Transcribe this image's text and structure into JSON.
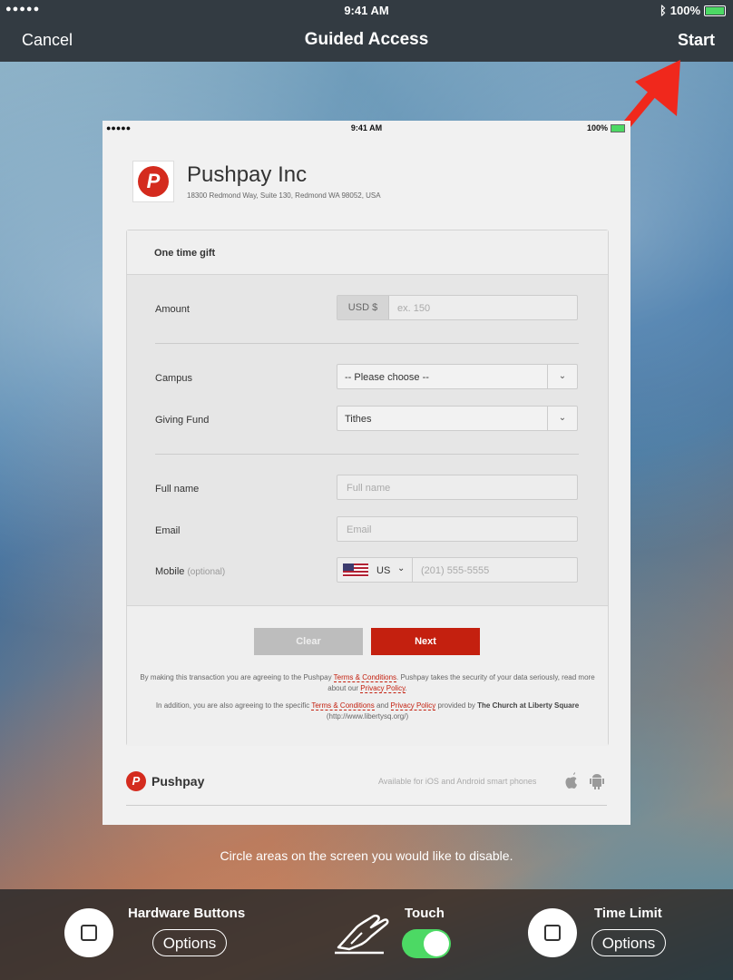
{
  "status_bar": {
    "signal": "●●●●● ",
    "time": "9:41 AM",
    "battery": "100%"
  },
  "nav": {
    "cancel": "Cancel",
    "title": "Guided Access",
    "start": "Start"
  },
  "inner_status": {
    "signal": "●●●●● ",
    "time": "9:41 AM",
    "battery": "100%"
  },
  "merchant": {
    "name": "Pushpay Inc",
    "address": "18300 Redmond Way, Suite 130, Redmond WA 98052, USA"
  },
  "form": {
    "header": "One time gift",
    "amount": {
      "label": "Amount",
      "currency": "USD $",
      "placeholder": "ex. 150"
    },
    "campus": {
      "label": "Campus",
      "value": "-- Please choose --"
    },
    "fund": {
      "label": "Giving Fund",
      "value": "Tithes"
    },
    "full_name": {
      "label": "Full name",
      "placeholder": "Full name"
    },
    "email": {
      "label": "Email",
      "placeholder": "Email"
    },
    "mobile": {
      "label": "Mobile",
      "optional": "(optional)",
      "country": "US",
      "placeholder": "(201) 555-5555"
    },
    "clear": "Clear",
    "next": "Next",
    "legal1_a": "By making this transaction you are agreeing to the Pushpay ",
    "legal1_link": "Terms & Conditions",
    "legal1_b": ". Pushpay takes the security of your data seriously, read more about our ",
    "legal1_link2": "Privacy Policy",
    "legal1_c": ".",
    "legal2_a": "In addition, you are also agreeing to the specific ",
    "legal2_link": "Terms & Conditions",
    "legal2_b": " and ",
    "legal2_link2": "Privacy Policy",
    "legal2_c": " provided by ",
    "legal2_org": "The Church at Liberty Square",
    "legal2_url": " (http://www.libertysq.org/)"
  },
  "footer": {
    "brand": "Pushpay",
    "available": "Available for iOS and Android smart phones"
  },
  "hint": "Circle areas on the screen you would like to disable.",
  "bottom": {
    "hardware_label": "Hardware Buttons",
    "hardware_options": "Options",
    "touch_label": "Touch",
    "touch_on": true,
    "time_label": "Time Limit",
    "time_options": "Options"
  }
}
